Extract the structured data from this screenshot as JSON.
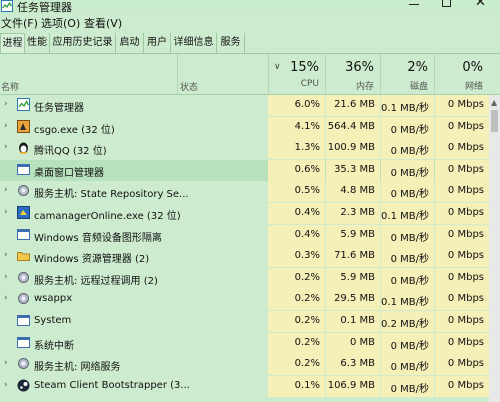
{
  "window": {
    "title": "任务管理器"
  },
  "menu": [
    "文件(F)",
    "选项(O)",
    "查看(V)"
  ],
  "tabs": [
    "进程",
    "性能",
    "应用历史记录",
    "启动",
    "用户",
    "详细信息",
    "服务"
  ],
  "header": {
    "name": "名称",
    "status": "状态",
    "cpu": {
      "pct": "15%",
      "label": "CPU"
    },
    "mem": {
      "pct": "36%",
      "label": "内存"
    },
    "disk": {
      "pct": "2%",
      "label": "磁盘"
    },
    "net": {
      "pct": "0%",
      "label": "网络"
    }
  },
  "processes": [
    {
      "name": "任务管理器",
      "cpu": "6.0%",
      "mem": "21.6 MB",
      "disk": "0.1 MB/秒",
      "net": "0 Mbps",
      "expander": true,
      "icon": "task-manager-icon"
    },
    {
      "name": "csgo.exe (32 位)",
      "cpu": "4.1%",
      "mem": "564.4 MB",
      "disk": "0 MB/秒",
      "net": "0 Mbps",
      "expander": true,
      "icon": "csgo-icon"
    },
    {
      "name": "腾讯QQ (32 位)",
      "cpu": "1.3%",
      "mem": "100.9 MB",
      "disk": "0 MB/秒",
      "net": "0 Mbps",
      "expander": true,
      "icon": "qq-penguin-icon"
    },
    {
      "name": "桌面窗口管理器",
      "cpu": "0.6%",
      "mem": "35.3 MB",
      "disk": "0 MB/秒",
      "net": "0 Mbps",
      "expander": false,
      "icon": "desktop-window-icon"
    },
    {
      "name": "服务主机: State Repository Se...",
      "cpu": "0.5%",
      "mem": "4.8 MB",
      "disk": "0 MB/秒",
      "net": "0 Mbps",
      "expander": true,
      "icon": "gear-icon"
    },
    {
      "name": "camanagerOnline.exe (32 位)",
      "cpu": "0.4%",
      "mem": "2.3 MB",
      "disk": "0.1 MB/秒",
      "net": "0 Mbps",
      "expander": true,
      "icon": "camanager-icon"
    },
    {
      "name": "Windows 音频设备图形隔离",
      "cpu": "0.4%",
      "mem": "5.9 MB",
      "disk": "0 MB/秒",
      "net": "0 Mbps",
      "expander": false,
      "icon": "window-app-icon"
    },
    {
      "name": "Windows 资源管理器 (2)",
      "cpu": "0.3%",
      "mem": "71.6 MB",
      "disk": "0 MB/秒",
      "net": "0 Mbps",
      "expander": true,
      "icon": "folder-icon"
    },
    {
      "name": "服务主机: 远程过程调用 (2)",
      "cpu": "0.2%",
      "mem": "5.9 MB",
      "disk": "0 MB/秒",
      "net": "0 Mbps",
      "expander": true,
      "icon": "gear-icon"
    },
    {
      "name": "wsappx",
      "cpu": "0.2%",
      "mem": "29.5 MB",
      "disk": "0.1 MB/秒",
      "net": "0 Mbps",
      "expander": true,
      "icon": "gear-icon"
    },
    {
      "name": "System",
      "cpu": "0.2%",
      "mem": "0.1 MB",
      "disk": "0.2 MB/秒",
      "net": "0 Mbps",
      "expander": false,
      "icon": "window-app-icon"
    },
    {
      "name": "系统中断",
      "cpu": "0.2%",
      "mem": "0 MB",
      "disk": "0 MB/秒",
      "net": "0 Mbps",
      "expander": false,
      "icon": "window-app-icon"
    },
    {
      "name": "服务主机: 网络服务",
      "cpu": "0.2%",
      "mem": "6.3 MB",
      "disk": "0 MB/秒",
      "net": "0 Mbps",
      "expander": true,
      "icon": "gear-icon"
    },
    {
      "name": "Steam Client Bootstrapper (3...",
      "cpu": "0.1%",
      "mem": "106.9 MB",
      "disk": "0 MB/秒",
      "net": "0 Mbps",
      "expander": true,
      "icon": "steam-icon"
    }
  ],
  "colors": {
    "background": "#cdeccf",
    "data_cell": "#f5efb8",
    "selected_row": "#b8e2bd"
  }
}
